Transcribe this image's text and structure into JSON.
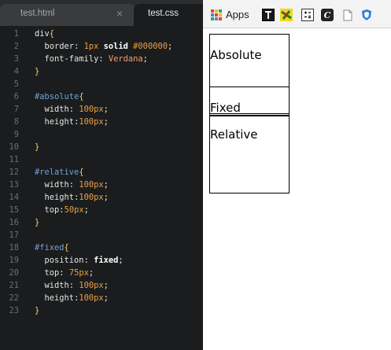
{
  "editor": {
    "tabs": [
      {
        "label": "test.html",
        "close": "×",
        "active": false
      },
      {
        "label": "test.css",
        "active": true
      }
    ],
    "lines": [
      {
        "n": "1",
        "tokens": [
          [
            "sel",
            "div"
          ],
          [
            "brace",
            "{"
          ]
        ]
      },
      {
        "n": "2",
        "tokens": [
          [
            "p",
            "  "
          ],
          [
            "prop",
            "border"
          ],
          [
            "p",
            ": "
          ],
          [
            "num",
            "1px"
          ],
          [
            "p",
            " "
          ],
          [
            "kw",
            "solid"
          ],
          [
            "p",
            " "
          ],
          [
            "num",
            "#000000"
          ],
          [
            "p",
            ";"
          ]
        ]
      },
      {
        "n": "3",
        "tokens": [
          [
            "p",
            "  "
          ],
          [
            "prop",
            "font-family"
          ],
          [
            "p",
            ": "
          ],
          [
            "val",
            "Verdana"
          ],
          [
            "p",
            ";"
          ]
        ]
      },
      {
        "n": "4",
        "tokens": [
          [
            "brace",
            "}"
          ]
        ]
      },
      {
        "n": "5",
        "tokens": []
      },
      {
        "n": "6",
        "tokens": [
          [
            "id",
            "#absolute"
          ],
          [
            "brace",
            "{"
          ]
        ]
      },
      {
        "n": "7",
        "tokens": [
          [
            "p",
            "  "
          ],
          [
            "prop",
            "width"
          ],
          [
            "p",
            ": "
          ],
          [
            "num",
            "100px"
          ],
          [
            "p",
            ";"
          ]
        ]
      },
      {
        "n": "8",
        "tokens": [
          [
            "p",
            "  "
          ],
          [
            "prop",
            "height"
          ],
          [
            "p",
            ":"
          ],
          [
            "num",
            "100px"
          ],
          [
            "p",
            ";"
          ]
        ]
      },
      {
        "n": "9",
        "tokens": []
      },
      {
        "n": "10",
        "tokens": [
          [
            "brace",
            "}"
          ]
        ]
      },
      {
        "n": "11",
        "tokens": []
      },
      {
        "n": "12",
        "tokens": [
          [
            "id",
            "#relative"
          ],
          [
            "brace",
            "{"
          ]
        ]
      },
      {
        "n": "13",
        "tokens": [
          [
            "p",
            "  "
          ],
          [
            "prop",
            "width"
          ],
          [
            "p",
            ": "
          ],
          [
            "num",
            "100px"
          ],
          [
            "p",
            ";"
          ]
        ]
      },
      {
        "n": "14",
        "tokens": [
          [
            "p",
            "  "
          ],
          [
            "prop",
            "height"
          ],
          [
            "p",
            ":"
          ],
          [
            "num",
            "100px"
          ],
          [
            "p",
            ";"
          ]
        ]
      },
      {
        "n": "15",
        "tokens": [
          [
            "p",
            "  "
          ],
          [
            "prop",
            "top"
          ],
          [
            "p",
            ":"
          ],
          [
            "num",
            "50px"
          ],
          [
            "p",
            ";"
          ]
        ]
      },
      {
        "n": "16",
        "tokens": [
          [
            "brace",
            "}"
          ]
        ]
      },
      {
        "n": "17",
        "tokens": []
      },
      {
        "n": "18",
        "tokens": [
          [
            "id",
            "#fixed"
          ],
          [
            "brace",
            "{"
          ]
        ]
      },
      {
        "n": "19",
        "tokens": [
          [
            "p",
            "  "
          ],
          [
            "prop",
            "position"
          ],
          [
            "p",
            ": "
          ],
          [
            "kw",
            "fixed"
          ],
          [
            "p",
            ";"
          ]
        ]
      },
      {
        "n": "20",
        "tokens": [
          [
            "p",
            "  "
          ],
          [
            "prop",
            "top"
          ],
          [
            "p",
            ": "
          ],
          [
            "num",
            "75px"
          ],
          [
            "p",
            ";"
          ]
        ]
      },
      {
        "n": "21",
        "tokens": [
          [
            "p",
            "  "
          ],
          [
            "prop",
            "width"
          ],
          [
            "p",
            ": "
          ],
          [
            "num",
            "100px"
          ],
          [
            "p",
            ";"
          ]
        ]
      },
      {
        "n": "22",
        "tokens": [
          [
            "p",
            "  "
          ],
          [
            "prop",
            "height"
          ],
          [
            "p",
            ":"
          ],
          [
            "num",
            "100px"
          ],
          [
            "p",
            ";"
          ]
        ]
      },
      {
        "n": "23",
        "tokens": [
          [
            "brace",
            "}"
          ]
        ]
      }
    ]
  },
  "browser": {
    "bookmarks": {
      "apps_label": "Apps",
      "items": [
        "bookmark-1-icon",
        "bookmark-2-icon",
        "calculator-icon",
        "script-c-icon",
        "page-icon",
        "shield-icon"
      ]
    },
    "content": {
      "absolute_text": "Absolute",
      "fixed_text": "Fixed",
      "relative_text": "Relative"
    }
  }
}
